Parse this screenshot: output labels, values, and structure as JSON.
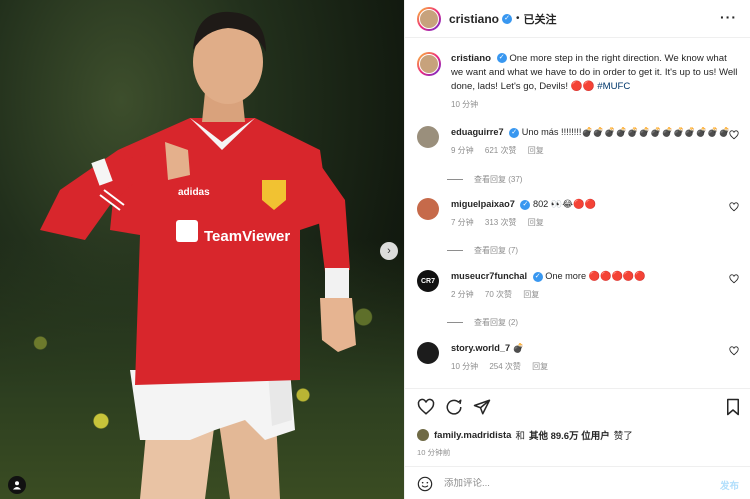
{
  "photo": {
    "shirt_sponsor": "TeamViewer",
    "brand": "adidas",
    "next_arrow": "›",
    "tag_icon": "user-icon"
  },
  "header": {
    "username": "cristiano",
    "separator": "•",
    "follow_label": "已关注",
    "more_label": "···"
  },
  "caption": {
    "username": "cristiano",
    "text": "One more step in the right direction. We know what we want and what we have to do in order to get it. It's up to us! Well done, lads! Let's go, Devils! 🔴🔴 ",
    "hashtag": "#MUFC",
    "time": "10 分钟"
  },
  "comments": [
    {
      "username": "eduaguirre7",
      "text": "Uno más !!!!!!!!💣💣💣💣💣💣💣💣💣💣💣💣💣",
      "time": "9 分钟",
      "likes": "621 次赞",
      "reply_label": "回复",
      "view_replies": "查看回复 (37)",
      "avatar_color": "#9a8f7c"
    },
    {
      "username": "miguelpaixao7",
      "text": "802 👀😂🔴🔴",
      "time": "7 分钟",
      "likes": "313 次赞",
      "reply_label": "回复",
      "view_replies": "查看回复 (7)",
      "avatar_color": "#c66a4a"
    },
    {
      "username": "museucr7funchal",
      "text": "One more 🔴🔴🔴🔴🔴",
      "time": "2 分钟",
      "likes": "70 次赞",
      "reply_label": "回复",
      "view_replies": "查看回复 (2)",
      "avatar_color": "#111111",
      "avatar_text": "CR7"
    },
    {
      "username": "story.world_7",
      "text": "💣",
      "time": "10 分钟",
      "likes": "254 次赞",
      "reply_label": "回复",
      "avatar_color": "#1c1c1c"
    }
  ],
  "actions": {
    "icons": [
      "heart-icon",
      "comment-icon",
      "share-icon",
      "bookmark-icon"
    ],
    "liked_by_user": "family.madridista",
    "liked_and": "和",
    "liked_others": "其他 89.6万 位用户",
    "liked_suffix": "赞了",
    "time_ago": "10 分钟前",
    "comment_placeholder": "添加评论...",
    "post_label": "发布",
    "emoji_icon": "smiley-icon"
  },
  "colors": {
    "accent_blue": "#3897f0",
    "hashtag": "#00376b",
    "muted": "#8e8e8e",
    "shirt_red": "#d8262c"
  }
}
